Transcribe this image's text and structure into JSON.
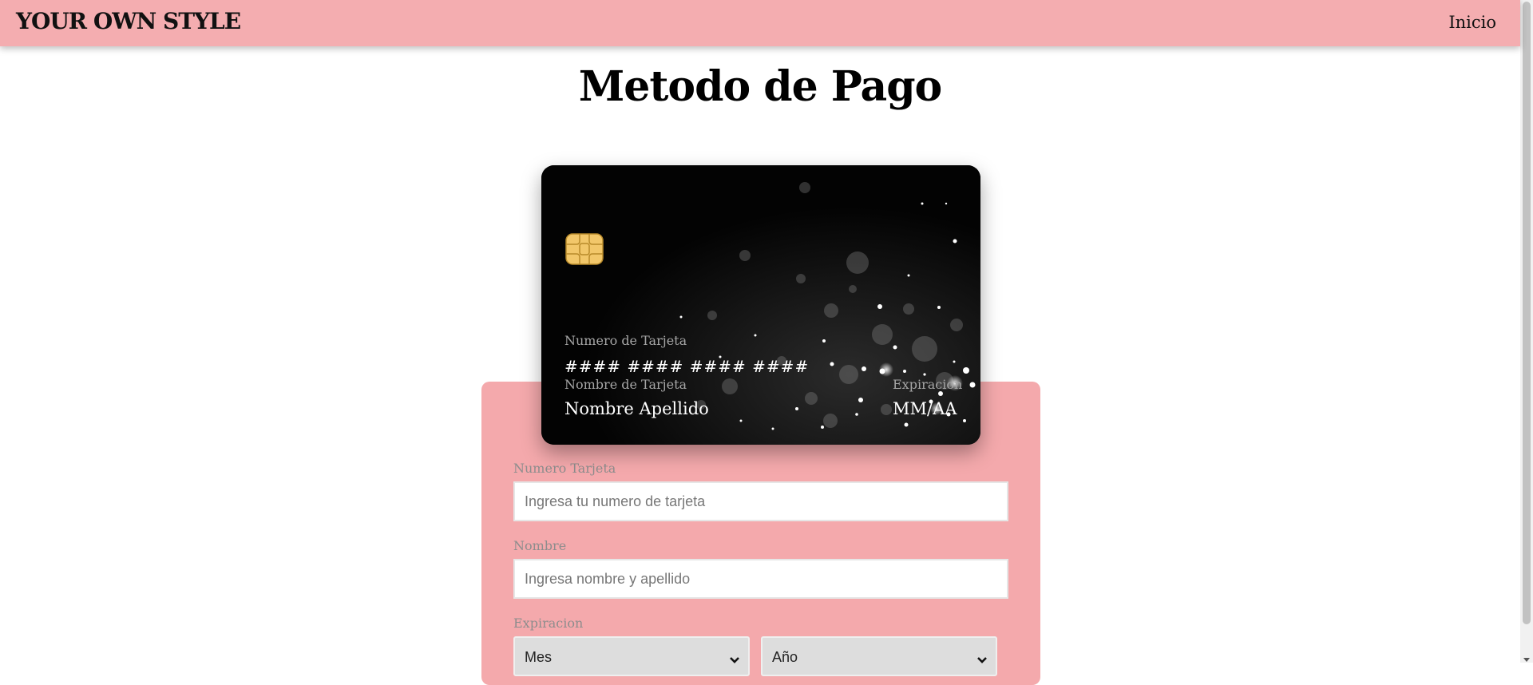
{
  "header": {
    "brand": "YOUR OWN STYLE",
    "nav_link": "Inicio"
  },
  "page": {
    "title": "Metodo de Pago"
  },
  "card": {
    "number_label": "Numero de Tarjeta",
    "number_value": "#### #### #### ####",
    "name_label": "Nombre de Tarjeta",
    "name_value": "Nombre Apellido",
    "expiry_label": "Expiracion",
    "expiry_value": "MM/AA"
  },
  "form": {
    "number_label": "Numero Tarjeta",
    "number_placeholder": "Ingresa tu numero de tarjeta",
    "name_label": "Nombre",
    "name_placeholder": "Ingresa nombre y apellido",
    "expiry_label": "Expiracion",
    "month_select": "Mes",
    "year_select": "Año"
  },
  "icons": {
    "chip": "card-chip-icon",
    "select_arrow": "chevron-down-icon"
  },
  "colors": {
    "navbar": "#f4adb0",
    "form_panel": "#f4a9ac",
    "card_background": "#030303",
    "chip_gold": "#f2c76a"
  }
}
